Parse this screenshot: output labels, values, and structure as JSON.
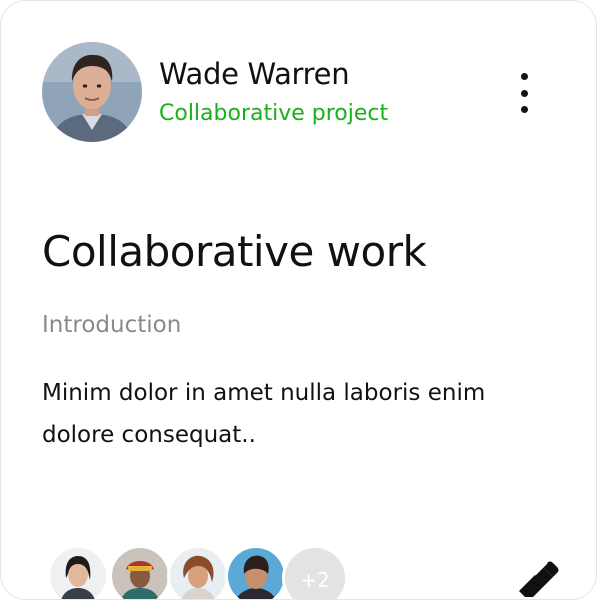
{
  "user": {
    "name": "Wade Warren",
    "subtitle": "Collaborative project"
  },
  "card": {
    "title": "Collaborative work",
    "subtitle": "Introduction",
    "body": "Minim dolor in amet nulla laboris enim dolore consequat.."
  },
  "members": {
    "extra_count": "+2"
  },
  "icons": {
    "menu": "more-vertical-icon",
    "edit": "pen-icon"
  },
  "colors": {
    "accent": "#19b019",
    "text": "#111111",
    "muted": "#8a8a8a"
  }
}
